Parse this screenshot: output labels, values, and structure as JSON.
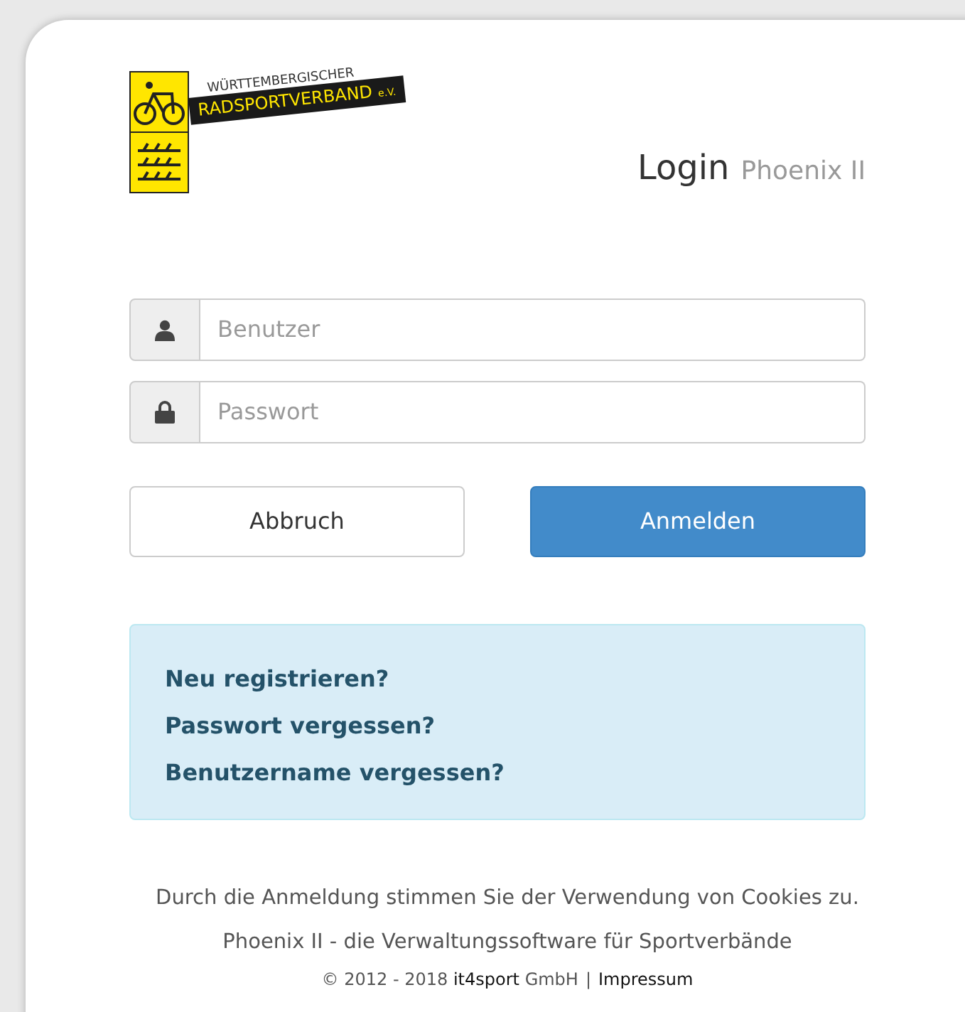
{
  "logo": {
    "line_1": "WÜRTTEMBERGISCHER",
    "line_2": "RADSPORTVERBAND",
    "suffix": "e.V."
  },
  "heading": {
    "title": "Login",
    "subtitle": "Phoenix II"
  },
  "fields": [
    {
      "kind": "user",
      "placeholder": "Benutzer"
    },
    {
      "kind": "password",
      "placeholder": "Passwort"
    }
  ],
  "buttons": [
    {
      "label": "Abbruch",
      "kind": "default"
    },
    {
      "label": "Anmelden",
      "kind": "primary"
    }
  ],
  "help_links": [
    "Neu registrieren?",
    "Passwort vergessen?",
    "Benutzername vergessen?"
  ],
  "footer": {
    "cookie_notice": "Durch die Anmeldung stimmen Sie der Verwendung von Cookies zu.",
    "tagline": "Phoenix II - die Verwaltungssoftware für Sportverbände",
    "copyright": "© 2012 - 2018 **it4sport** GmbH",
    "separator": "|",
    "imprint_link": "Impressum"
  }
}
